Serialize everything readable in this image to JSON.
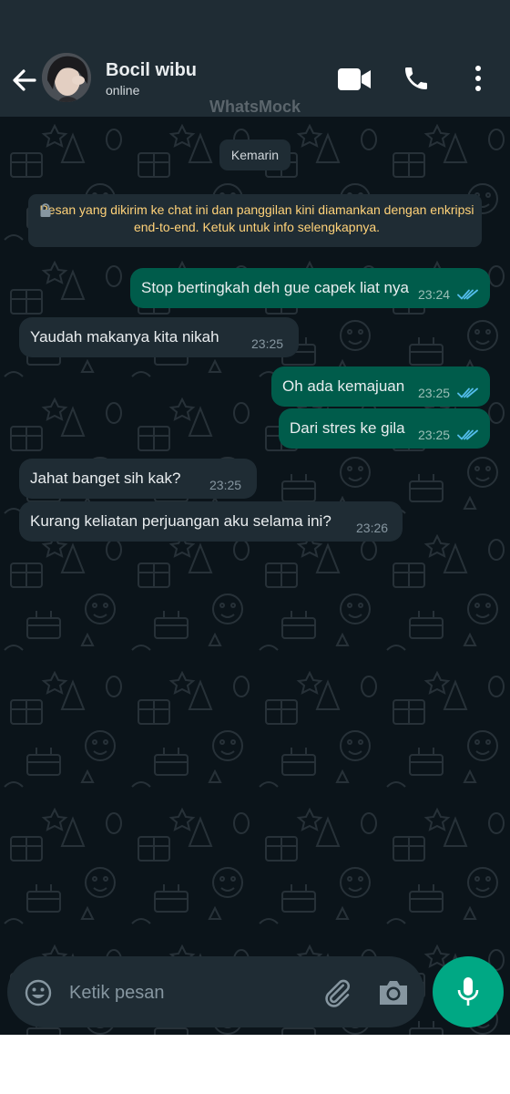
{
  "header": {
    "contact_name": "Bocil wibu",
    "status": "online",
    "watermark": "WhatsMock"
  },
  "chat": {
    "date_chip": "Kemarin",
    "encryption_notice": "Pesan yang dikirim ke chat ini dan panggilan kini diamankan dengan enkripsi end-to-end. Ketuk untuk info selengkapnya.",
    "messages": [
      {
        "direction": "out",
        "text": "Stop bertingkah deh gue capek liat nya",
        "time": "23:24",
        "read": true
      },
      {
        "direction": "in",
        "text": "Yaudah makanya kita nikah",
        "time": "23:25"
      },
      {
        "direction": "out",
        "text": "Oh ada kemajuan",
        "time": "23:25",
        "read": true
      },
      {
        "direction": "out",
        "text": "Dari stres ke gila",
        "time": "23:25",
        "read": true
      },
      {
        "direction": "in",
        "text": "Jahat banget sih kak?",
        "time": "23:25"
      },
      {
        "direction": "in",
        "text": "Kurang keliatan perjuangan aku selama ini?",
        "time": "23:26"
      }
    ]
  },
  "composer": {
    "placeholder": "Ketik pesan"
  },
  "icons": {
    "back": "arrow-left-icon",
    "video_call": "video-camera-icon",
    "voice_call": "phone-icon",
    "menu": "more-vertical-icon",
    "emoji": "emoji-icon",
    "attach": "paperclip-icon",
    "camera": "camera-icon",
    "mic": "microphone-icon"
  },
  "colors": {
    "background": "#0b141a",
    "header": "#1f2c34",
    "outgoing_bubble": "#005c4b",
    "incoming_bubble": "#1f2c34",
    "read_ticks": "#53bdeb",
    "notice_text": "#ffd279",
    "accent": "#00a884"
  }
}
